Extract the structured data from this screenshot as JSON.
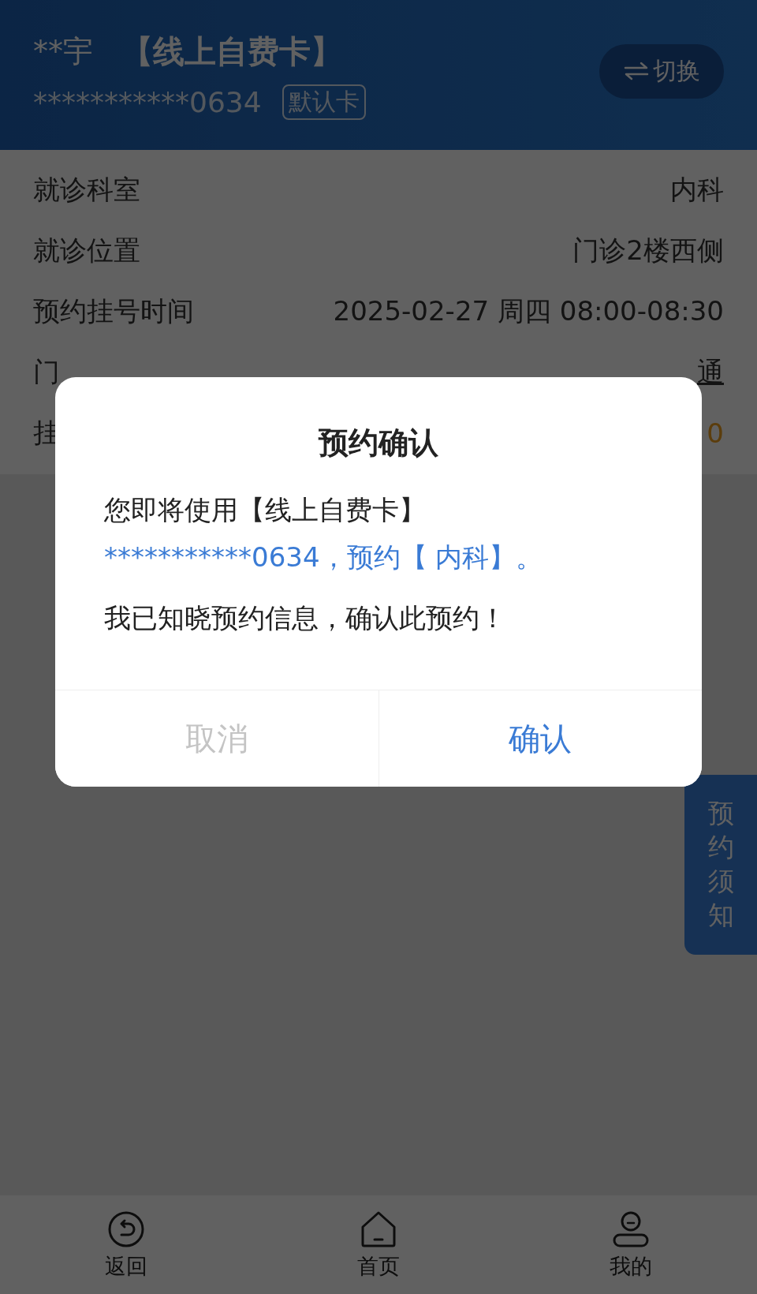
{
  "header": {
    "patient_name": "**宇",
    "card_type": "【线上自费卡】",
    "card_number": "***********0634",
    "badge": "默认卡",
    "switch_button": "切换"
  },
  "details": [
    {
      "label": "就诊科室",
      "value": "内科",
      "kind": "plain"
    },
    {
      "label": "就诊位置",
      "value": "门诊2楼西侧",
      "kind": "plain"
    },
    {
      "label": "预约挂号时间",
      "value": "2025-02-27 周四 08:00-08:30",
      "kind": "plain"
    },
    {
      "label": "门",
      "value": "通",
      "kind": "link"
    },
    {
      "label": "挂",
      "value": "0",
      "kind": "price"
    }
  ],
  "side_tab": "预约须知",
  "dialog": {
    "title": "预约确认",
    "message": {
      "text": "您即将使用【线上自费卡】",
      "highlight": "***********0634，预约【 内科】。"
    },
    "confirmation": "我已知晓预约信息，确认此预约！",
    "buttons": [
      {
        "label": "取消",
        "kind": "cancel"
      },
      {
        "label": "确认",
        "kind": "confirm"
      }
    ]
  },
  "bottom_nav": [
    {
      "label": "返回",
      "kind": "back"
    },
    {
      "label": "首页",
      "kind": "home"
    },
    {
      "label": "我的",
      "kind": "profile"
    }
  ]
}
